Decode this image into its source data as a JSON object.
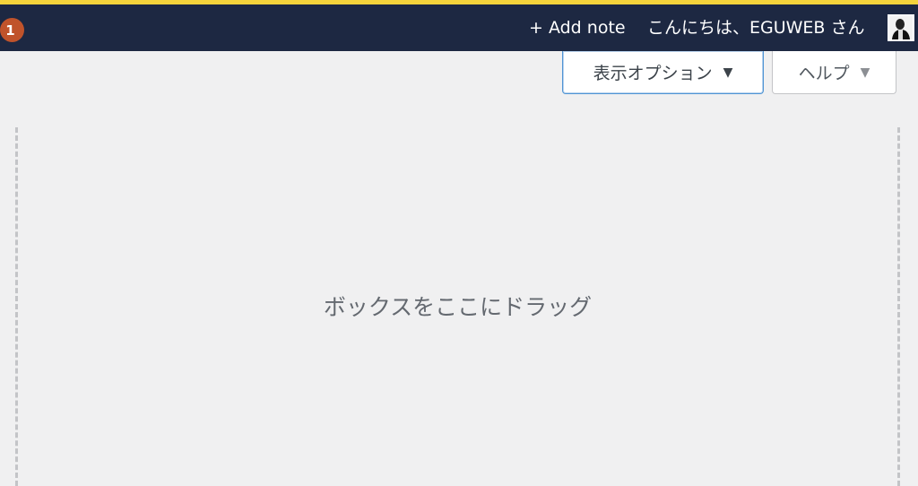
{
  "admin_bar": {
    "update_count": "1",
    "add_note_label": "+ Add note",
    "greeting": "こんにちは、EGUWEB さん",
    "avatar_icon": "user-avatar-icon"
  },
  "screen_meta": {
    "screen_options_label": "表示オプション",
    "help_label": "ヘルプ",
    "caret": "▼"
  },
  "dashboard": {
    "empty_drop_text": "ボックスをここにドラッグ"
  },
  "colors": {
    "admin_bar_bg": "#1d2842",
    "accent_strip": "#f5d33b",
    "badge": "#c0532b",
    "page_bg": "#f0f0f1"
  }
}
